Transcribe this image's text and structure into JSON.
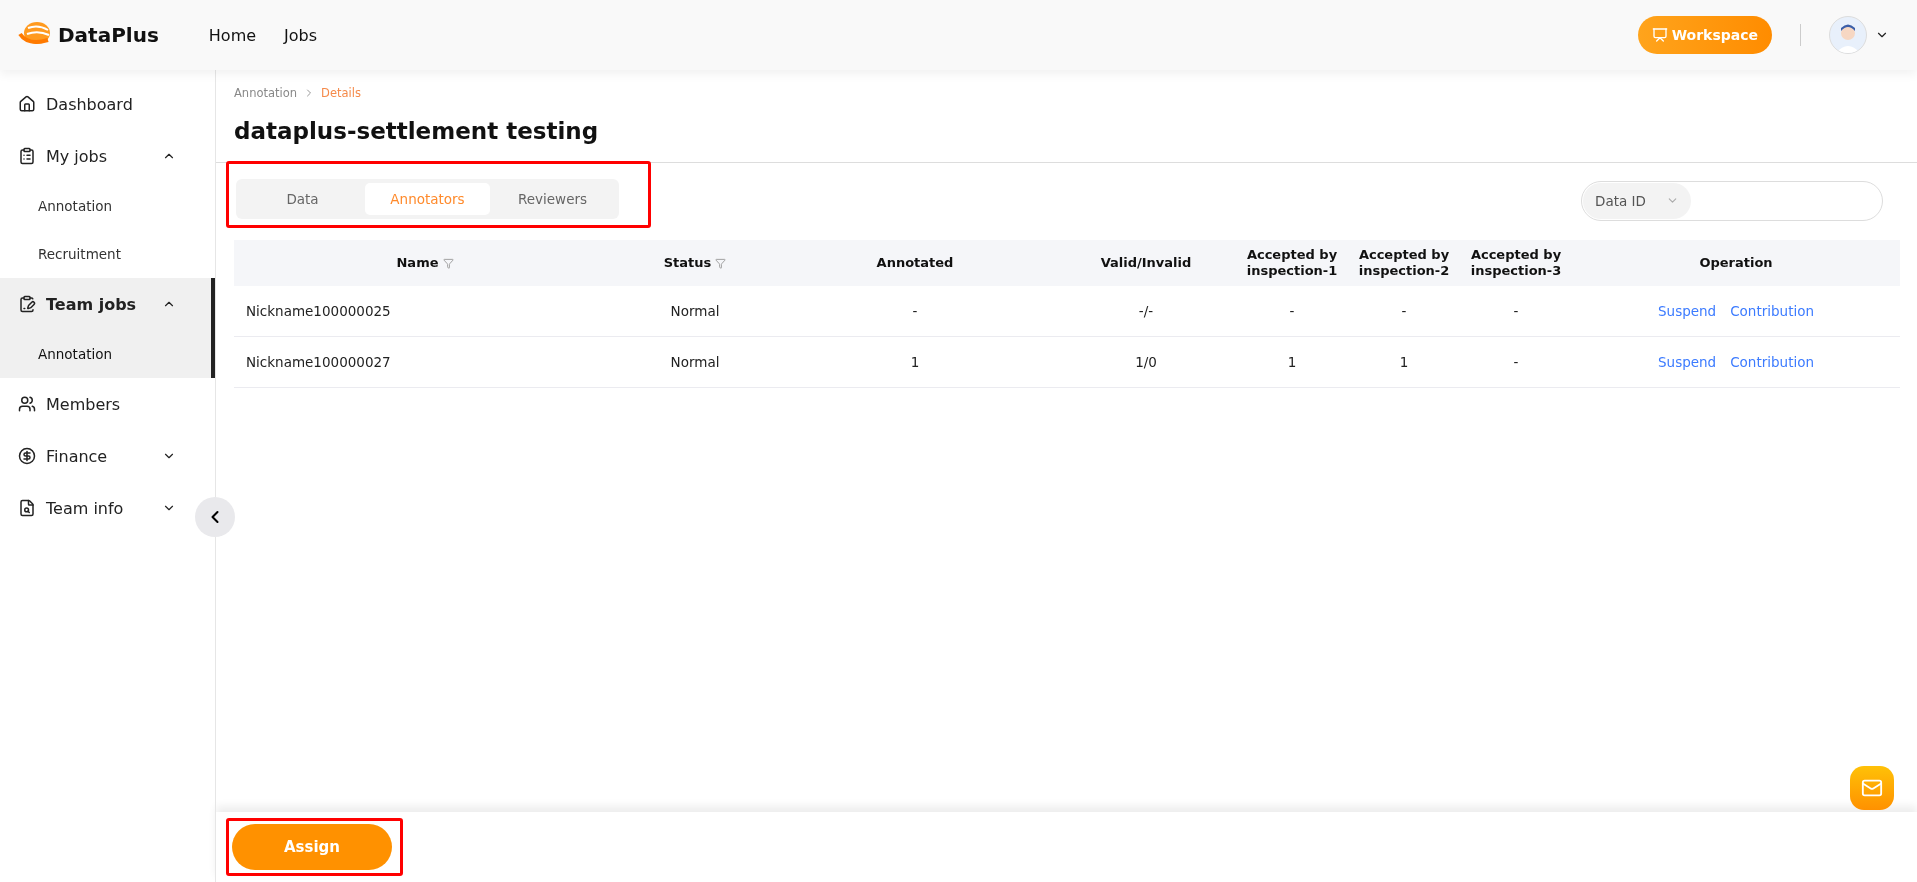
{
  "header": {
    "brand": "DataPlus",
    "nav": [
      {
        "label": "Home"
      },
      {
        "label": "Jobs"
      }
    ],
    "workspace_button": "Workspace"
  },
  "sidebar": {
    "items": [
      {
        "label": "Dashboard",
        "selected": false
      },
      {
        "label": "My jobs",
        "expanded": true,
        "selected": false,
        "children": [
          {
            "label": "Annotation",
            "selected": false
          },
          {
            "label": "Recruitment",
            "selected": false
          }
        ]
      },
      {
        "label": "Team jobs",
        "expanded": true,
        "selected": true,
        "children": [
          {
            "label": "Annotation",
            "selected": true
          }
        ]
      },
      {
        "label": "Members",
        "selected": false
      },
      {
        "label": "Finance",
        "expanded": false,
        "selected": false
      },
      {
        "label": "Team info",
        "expanded": false,
        "selected": false
      }
    ]
  },
  "breadcrumb": [
    "Annotation",
    "Details"
  ],
  "page_title": "dataplus-settlement testing",
  "tabs": [
    {
      "label": "Data",
      "selected": false
    },
    {
      "label": "Annotators",
      "selected": true
    },
    {
      "label": "Reviewers",
      "selected": false
    }
  ],
  "search": {
    "filter": "Data ID"
  },
  "table": {
    "columns": [
      {
        "label": "Name",
        "filter": true
      },
      {
        "label": "Status",
        "filter": true
      },
      {
        "label": "Annotated",
        "filter": false
      },
      {
        "label": "Valid/Invalid",
        "filter": false
      },
      {
        "label": "Accepted by inspection-1",
        "filter": false
      },
      {
        "label": "Accepted by inspection-2",
        "filter": false
      },
      {
        "label": "Accepted by inspection-3",
        "filter": false
      },
      {
        "label": "Operation",
        "filter": false
      }
    ],
    "rows": [
      {
        "cells": [
          "Nickname100000025",
          "Normal",
          "-",
          "-/-",
          "-",
          "-",
          "-"
        ],
        "actions": [
          "Suspend",
          "Contribution"
        ]
      },
      {
        "cells": [
          "Nickname100000027",
          "Normal",
          "1",
          "1/0",
          "1",
          "1",
          "-"
        ],
        "actions": [
          "Suspend",
          "Contribution"
        ]
      }
    ]
  },
  "footer": {
    "assign_button": "Assign"
  }
}
